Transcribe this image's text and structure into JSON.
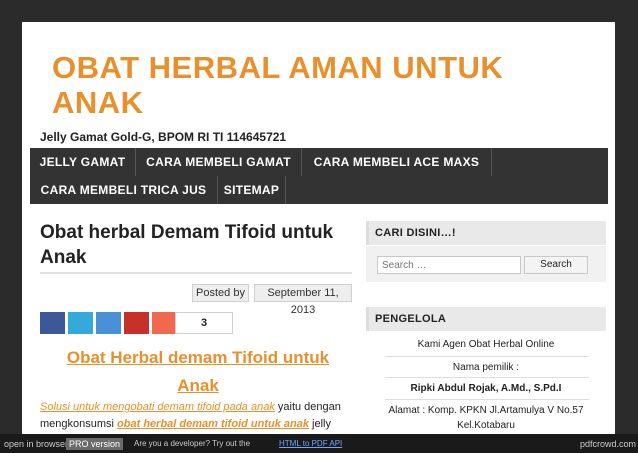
{
  "site": {
    "title": "OBAT HERBAL AMAN UNTUK ANAK",
    "tagline": "Jelly Gamat Gold-G, BPOM RI TI 114645721"
  },
  "nav": {
    "items": [
      "JELLY GAMAT",
      "CARA MEMBELI GAMAT",
      "CARA MEMBELI ACE MAXS",
      "CARA MEMBELI TRICA JUS",
      "SITEMAP"
    ]
  },
  "post": {
    "title": "Obat herbal Demam Tifoid untuk Anak",
    "posted_by": "Posted by",
    "date": "September 11, 2013",
    "share_count": "3",
    "content_title_line1": "Obat Herbal demam Tifoid untuk",
    "content_title_line2": "Anak",
    "content_link1": "Solusi untuk mengobati demam tifoid pada anak",
    "content_text1": " yaitu dengan",
    "content_text2": "mengkonsumsi ",
    "content_link2": "obat herbal demam tifoid untuk anak",
    "content_text3": " jelly"
  },
  "sidebar": {
    "search_heading": "CARI DISINI…!",
    "search_placeholder": "Search …",
    "search_button": "Search",
    "pengelola_heading": "PENGELOLA",
    "lines": [
      "Kami Agen Obat Herbal Online",
      "Nama pemilik :",
      "Ripki Abdul Rojak, A.Md., S.Pd.I",
      "Alamat : Komp. KPKN Jl.Artamulya V No.57",
      "Kel.Kotabaru"
    ]
  },
  "pdfbar": {
    "open_in_browser": "open in browser",
    "pro_version": "PRO version",
    "developer_text": "Are you a developer? Try out the",
    "api_link": "HTML to PDF API",
    "brand": "pdfcrowd.com"
  },
  "colors": {
    "accent": "#e8902c",
    "nav_bg": "#333333",
    "share_buttons": [
      "#3b5998",
      "#35a9d9",
      "#4a90d9",
      "#c8312a",
      "#f0684e"
    ]
  }
}
